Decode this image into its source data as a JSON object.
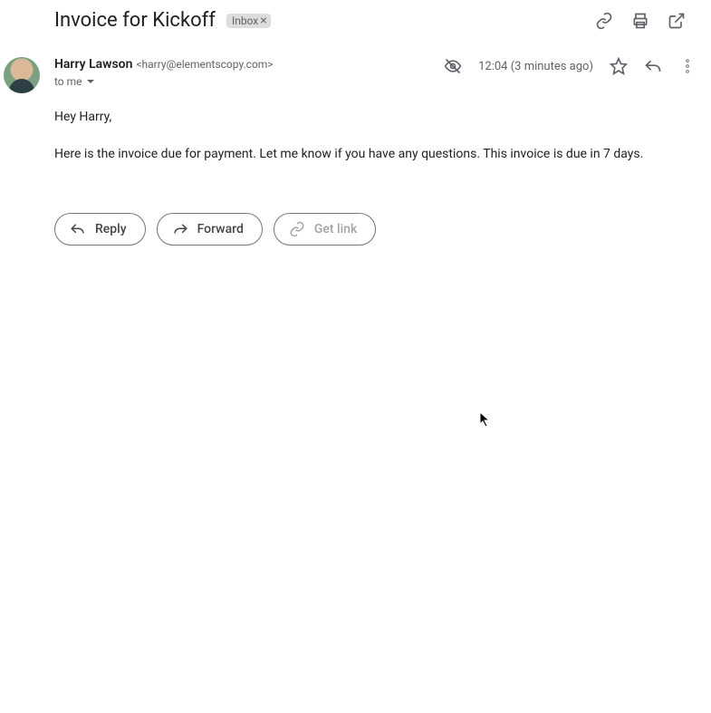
{
  "subject": "Invoice for Kickoff",
  "label": {
    "name": "Inbox"
  },
  "sender": {
    "name": "Harry Lawson",
    "email": "<harry@elementscopy.com>"
  },
  "recipient": {
    "line": "to me"
  },
  "timestamp": "12:04 (3 minutes ago)",
  "body": {
    "greeting": "Hey Harry,",
    "paragraph1": "Here is the invoice due for payment. Let me know if you have any questions. This invoice is due in 7 days."
  },
  "actions": {
    "reply": "Reply",
    "forward": "Forward",
    "getlink": "Get link"
  }
}
